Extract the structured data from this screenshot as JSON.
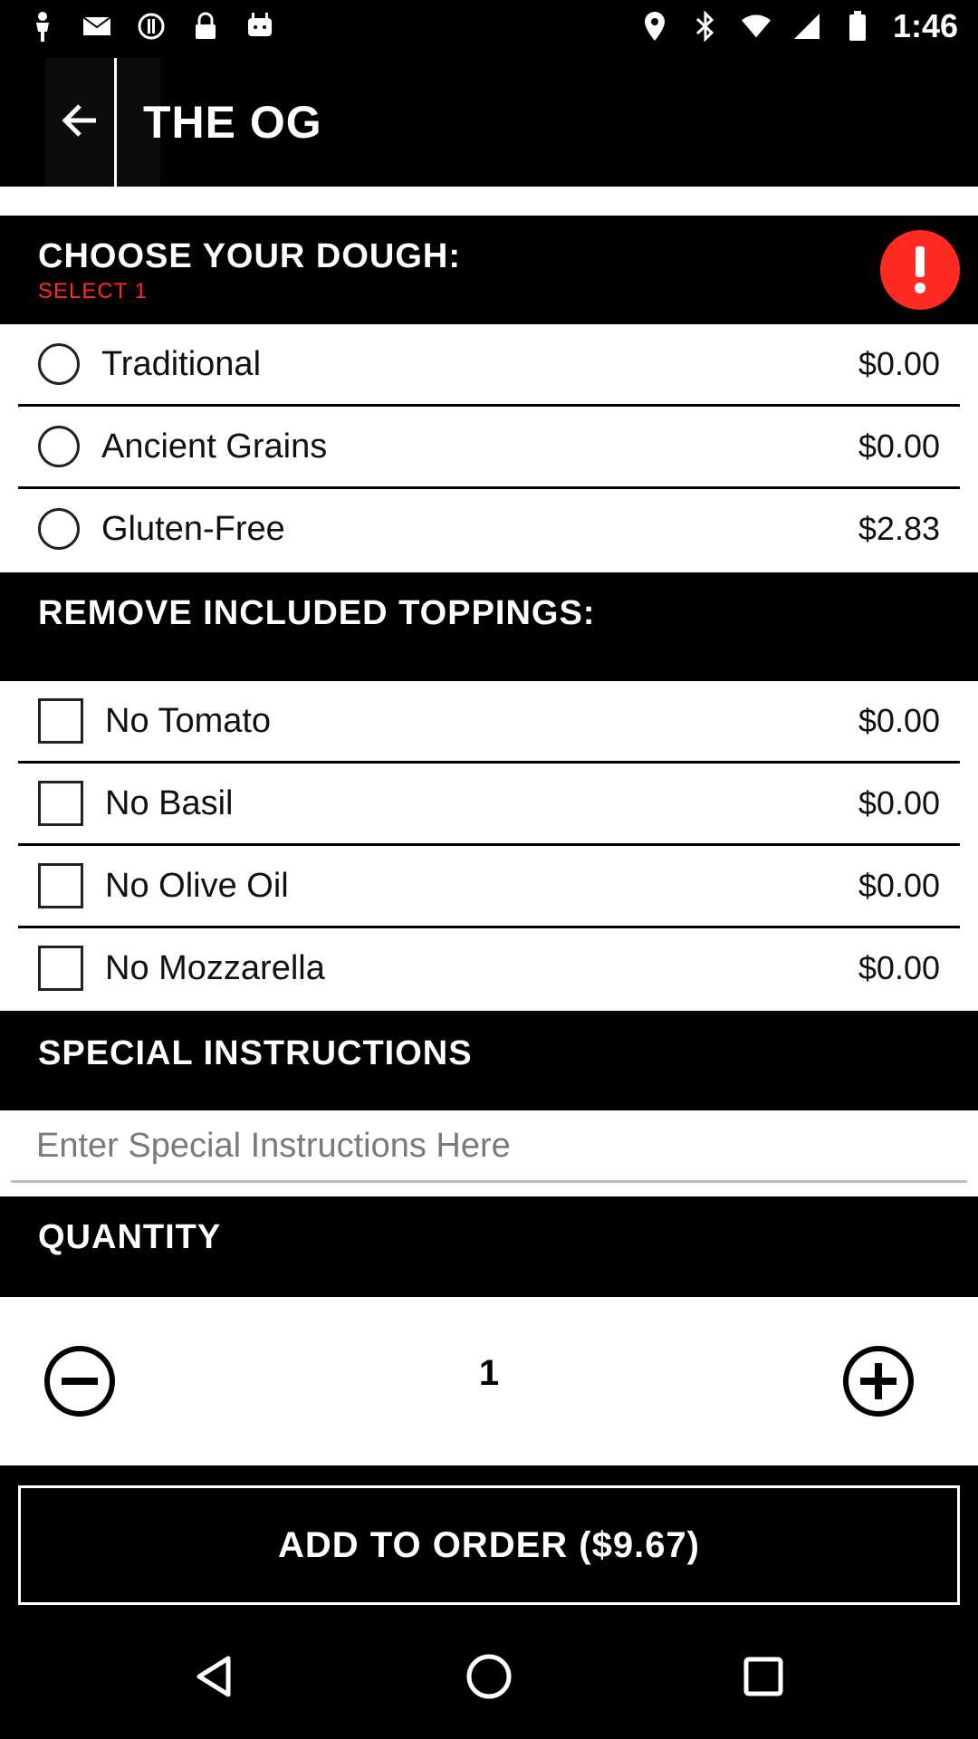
{
  "status_bar": {
    "time": "1:46",
    "left_icons": [
      "person-icon",
      "mail-icon",
      "circle-alert-icon",
      "lock-icon",
      "android-icon"
    ],
    "right_icons": [
      "location-icon",
      "bluetooth-icon",
      "wifi-icon",
      "signal-icon",
      "battery-icon"
    ]
  },
  "header": {
    "title": "THE OG"
  },
  "dough": {
    "title": "CHOOSE YOUR DOUGH:",
    "subtitle": "SELECT 1",
    "options": [
      {
        "label": "Traditional",
        "price": "$0.00"
      },
      {
        "label": "Ancient Grains",
        "price": "$0.00"
      },
      {
        "label": "Gluten-Free",
        "price": "$2.83"
      }
    ]
  },
  "toppings": {
    "title": "REMOVE INCLUDED TOPPINGS:",
    "options": [
      {
        "label": "No Tomato",
        "price": "$0.00"
      },
      {
        "label": "No Basil",
        "price": "$0.00"
      },
      {
        "label": "No Olive Oil",
        "price": "$0.00"
      },
      {
        "label": "No Mozzarella",
        "price": "$0.00"
      }
    ]
  },
  "instructions": {
    "title": "SPECIAL INSTRUCTIONS",
    "placeholder": "Enter Special Instructions Here"
  },
  "quantity": {
    "title": "QUANTITY",
    "value": "1"
  },
  "add_button": {
    "label": "ADD TO ORDER ($9.67)"
  },
  "colors": {
    "accent_red": "#ff2a22",
    "background": "#ffffff",
    "header_bg": "#000000"
  }
}
